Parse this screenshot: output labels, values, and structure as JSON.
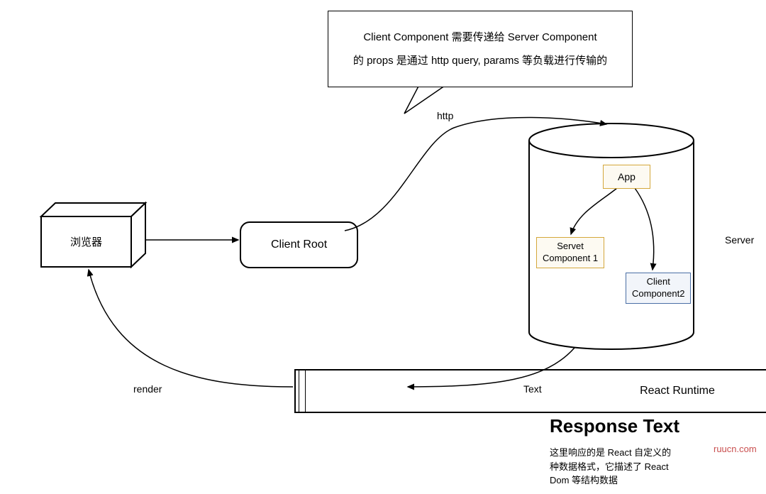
{
  "callout": {
    "line1": "Client Component 需要传递给 Server Component",
    "line2": "的 props 是通过 http query, params 等负载进行传输的"
  },
  "nodes": {
    "browser": "浏览器",
    "client_root": "Client Root",
    "react_runtime": "React Runtime",
    "app": "App",
    "servet_component1": "Servet\nComponent 1",
    "client_component2": "Client\nComponent2",
    "server_label": "Server"
  },
  "edges": {
    "http": "http",
    "text": "Text",
    "render": "render"
  },
  "response": {
    "heading": "Response Text",
    "desc_l1": "这里响应的是 React 自定义的",
    "desc_l2": "种数据格式，它描述了 React",
    "desc_l3": "Dom 等结构数据"
  },
  "watermark": "ruucn.com"
}
